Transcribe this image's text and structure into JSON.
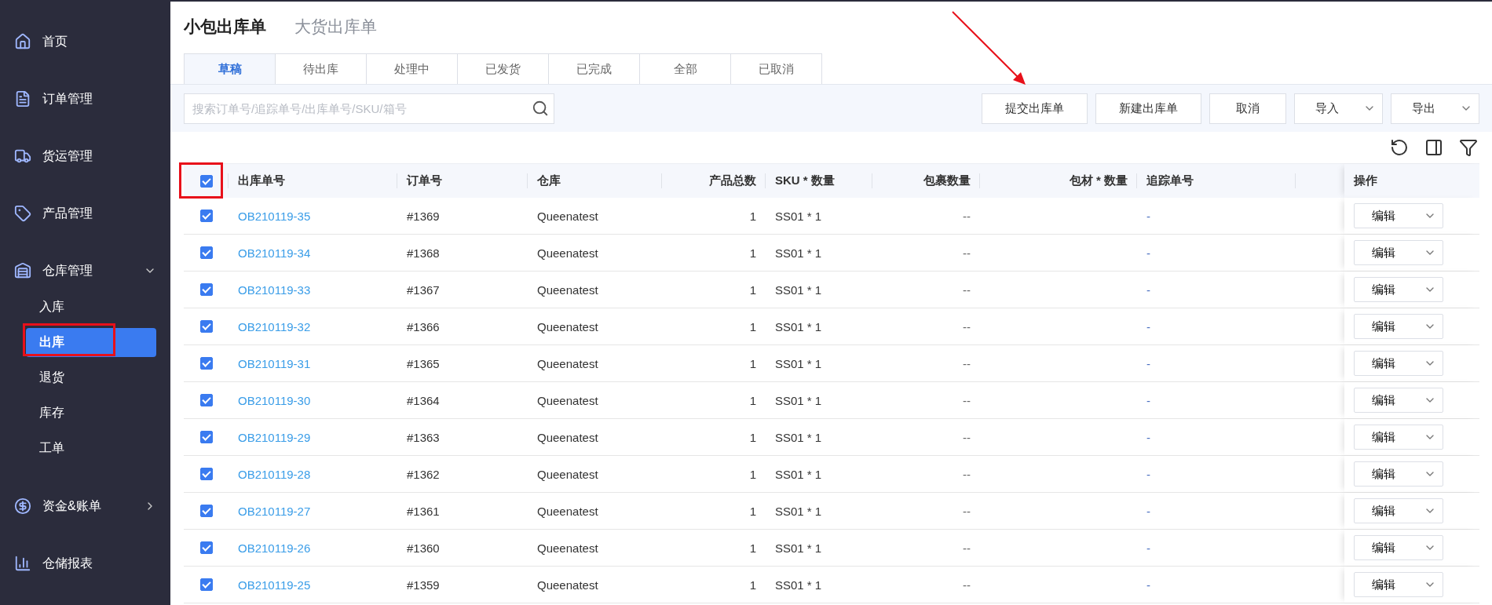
{
  "sidebar": {
    "items": [
      {
        "label": "首页",
        "selected": false
      },
      {
        "label": "订单管理",
        "selected": false
      },
      {
        "label": "货运管理",
        "selected": false
      },
      {
        "label": "产品管理",
        "selected": false
      },
      {
        "label": "仓库管理",
        "selected": false,
        "expanded": true,
        "children": [
          {
            "label": "入库",
            "selected": false
          },
          {
            "label": "出库",
            "selected": true
          },
          {
            "label": "退货",
            "selected": false
          },
          {
            "label": "库存",
            "selected": false
          },
          {
            "label": "工单",
            "selected": false
          }
        ]
      },
      {
        "label": "资金&账单",
        "selected": false,
        "expanded": false
      },
      {
        "label": "仓储报表",
        "selected": false
      }
    ]
  },
  "page_tabs": [
    {
      "label": "小包出库单",
      "selected": true
    },
    {
      "label": "大货出库单",
      "selected": false
    }
  ],
  "status_tabs": [
    {
      "label": "草稿",
      "selected": true
    },
    {
      "label": "待出库",
      "selected": false
    },
    {
      "label": "处理中",
      "selected": false
    },
    {
      "label": "已发货",
      "selected": false
    },
    {
      "label": "已完成",
      "selected": false
    },
    {
      "label": "全部",
      "selected": false
    },
    {
      "label": "已取消",
      "selected": false
    }
  ],
  "search": {
    "placeholder": "搜索订单号/追踪单号/出库单号/SKU/箱号"
  },
  "buttons": [
    {
      "label": "提交出库单",
      "kind": "plain"
    },
    {
      "label": "新建出库单",
      "kind": "plain"
    },
    {
      "label": "取消",
      "kind": "plain"
    },
    {
      "label": "导入",
      "kind": "dropdown"
    },
    {
      "label": "导出",
      "kind": "dropdown"
    }
  ],
  "table": {
    "all_selected": true,
    "columns": [
      {
        "label": "出库单号"
      },
      {
        "label": "订单号"
      },
      {
        "label": "仓库"
      },
      {
        "label": "产品总数"
      },
      {
        "label": "SKU * 数量"
      },
      {
        "label": "包裹数量"
      },
      {
        "label": "包材 * 数量"
      },
      {
        "label": "追踪单号"
      },
      {
        "label": "操作"
      }
    ],
    "rows": [
      {
        "selected": true,
        "outbound_no": "OB210119-35",
        "order_no": "#1369",
        "warehouse": "Queenatest",
        "total_products": "1",
        "sku_qty": "SS01 * 1",
        "package_qty": "--",
        "tracking_no": "-",
        "action": "编辑"
      },
      {
        "selected": true,
        "outbound_no": "OB210119-34",
        "order_no": "#1368",
        "warehouse": "Queenatest",
        "total_products": "1",
        "sku_qty": "SS01 * 1",
        "package_qty": "--",
        "tracking_no": "-",
        "action": "编辑"
      },
      {
        "selected": true,
        "outbound_no": "OB210119-33",
        "order_no": "#1367",
        "warehouse": "Queenatest",
        "total_products": "1",
        "sku_qty": "SS01 * 1",
        "package_qty": "--",
        "tracking_no": "-",
        "action": "编辑"
      },
      {
        "selected": true,
        "outbound_no": "OB210119-32",
        "order_no": "#1366",
        "warehouse": "Queenatest",
        "total_products": "1",
        "sku_qty": "SS01 * 1",
        "package_qty": "--",
        "tracking_no": "-",
        "action": "编辑"
      },
      {
        "selected": true,
        "outbound_no": "OB210119-31",
        "order_no": "#1365",
        "warehouse": "Queenatest",
        "total_products": "1",
        "sku_qty": "SS01 * 1",
        "package_qty": "--",
        "tracking_no": "-",
        "action": "编辑"
      },
      {
        "selected": true,
        "outbound_no": "OB210119-30",
        "order_no": "#1364",
        "warehouse": "Queenatest",
        "total_products": "1",
        "sku_qty": "SS01 * 1",
        "package_qty": "--",
        "tracking_no": "-",
        "action": "编辑"
      },
      {
        "selected": true,
        "outbound_no": "OB210119-29",
        "order_no": "#1363",
        "warehouse": "Queenatest",
        "total_products": "1",
        "sku_qty": "SS01 * 1",
        "package_qty": "--",
        "tracking_no": "-",
        "action": "编辑"
      },
      {
        "selected": true,
        "outbound_no": "OB210119-28",
        "order_no": "#1362",
        "warehouse": "Queenatest",
        "total_products": "1",
        "sku_qty": "SS01 * 1",
        "package_qty": "--",
        "tracking_no": "-",
        "action": "编辑"
      },
      {
        "selected": true,
        "outbound_no": "OB210119-27",
        "order_no": "#1361",
        "warehouse": "Queenatest",
        "total_products": "1",
        "sku_qty": "SS01 * 1",
        "package_qty": "--",
        "tracking_no": "-",
        "action": "编辑"
      },
      {
        "selected": true,
        "outbound_no": "OB210119-26",
        "order_no": "#1360",
        "warehouse": "Queenatest",
        "total_products": "1",
        "sku_qty": "SS01 * 1",
        "package_qty": "--",
        "tracking_no": "-",
        "action": "编辑"
      },
      {
        "selected": true,
        "outbound_no": "OB210119-25",
        "order_no": "#1359",
        "warehouse": "Queenatest",
        "total_products": "1",
        "sku_qty": "SS01 * 1",
        "package_qty": "--",
        "tracking_no": "-",
        "action": "编辑"
      }
    ]
  }
}
